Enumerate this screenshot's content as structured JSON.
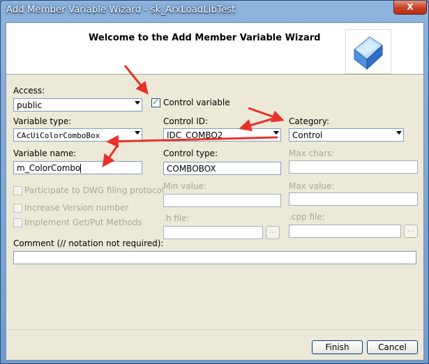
{
  "window": {
    "title": "Add Member Variable Wizard - sk_ArxLoadLibTest",
    "close_label": "X"
  },
  "header": {
    "title": "Welcome to the Add Member Variable Wizard"
  },
  "form": {
    "access": {
      "label": "Access:",
      "value": "public"
    },
    "control_variable": {
      "label": "Control variable",
      "checked": true
    },
    "variable_type": {
      "label": "Variable type:",
      "value": "CAcUiColorComboBox"
    },
    "control_id": {
      "label": "Control ID:",
      "value": "IDC_COMBO2"
    },
    "category": {
      "label": "Category:",
      "value": "Control"
    },
    "variable_name": {
      "label": "Variable name:",
      "value": "m_ColorCombo"
    },
    "control_type": {
      "label": "Control type:",
      "value": "COMBOBOX"
    },
    "max_chars": {
      "label": "Max chars:",
      "value": ""
    },
    "participate_dwg": {
      "label": "Participate to DWG filing protocol"
    },
    "increase_version": {
      "label": "Increase Version number"
    },
    "implement_getput": {
      "label": "Implement Get/Put Methods"
    },
    "min_value": {
      "label": "Min value:",
      "value": ""
    },
    "max_value": {
      "label": "Max value:",
      "value": ""
    },
    "h_file": {
      "label": ".h file:",
      "value": "",
      "browse": "..."
    },
    "cpp_file": {
      "label": ".cpp file:",
      "value": "",
      "browse": "..."
    },
    "comment": {
      "label": "Comment (// notation not required):",
      "value": ""
    }
  },
  "buttons": {
    "finish": "Finish",
    "cancel": "Cancel"
  },
  "colors": {
    "annotation_arrow": "#e8312a",
    "title_bar": "#7aa5d6",
    "dialog_face": "#ece9d8"
  }
}
